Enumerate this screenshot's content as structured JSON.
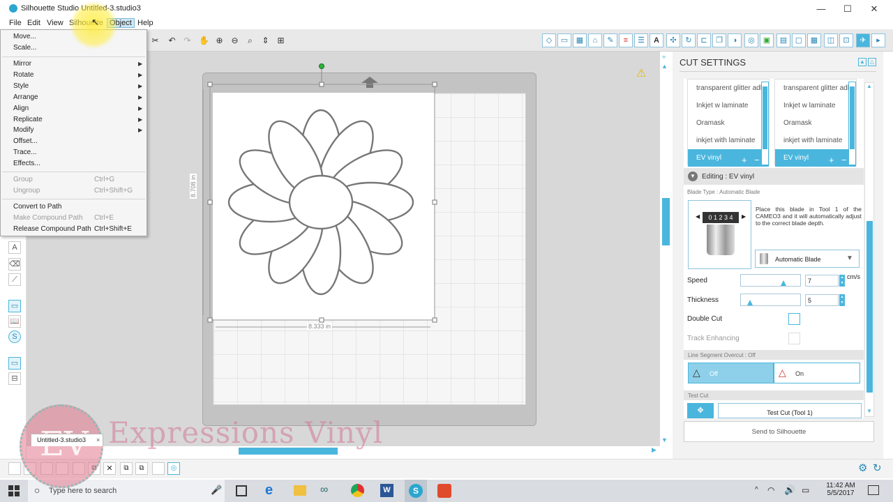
{
  "window": {
    "title_app": "Silhouette Studio",
    "title_doc": "Untitled-3.studio3",
    "minimize": "—",
    "maximize": "☐",
    "close": "✕"
  },
  "menubar": [
    "File",
    "Edit",
    "View",
    "Silhouette",
    "Object",
    "Help"
  ],
  "object_menu": {
    "items": [
      {
        "label": "Move...",
        "enabled": true
      },
      {
        "label": "Scale...",
        "enabled": true
      },
      {
        "label": "Mirror",
        "submenu": true
      },
      {
        "label": "Rotate",
        "submenu": true
      },
      {
        "label": "Style",
        "submenu": true
      },
      {
        "label": "Arrange",
        "submenu": true
      },
      {
        "label": "Align",
        "submenu": true
      },
      {
        "label": "Replicate",
        "submenu": true
      },
      {
        "label": "Modify",
        "submenu": true
      },
      {
        "label": "Offset...",
        "enabled": true
      },
      {
        "label": "Trace...",
        "enabled": true
      },
      {
        "label": "Effects...",
        "enabled": true
      },
      {
        "label": "Group",
        "shortcut": "Ctrl+G",
        "enabled": false
      },
      {
        "label": "Ungroup",
        "shortcut": "Ctrl+Shift+G",
        "enabled": false
      },
      {
        "label": "Convert to Path",
        "enabled": true
      },
      {
        "label": "Make Compound Path",
        "shortcut": "Ctrl+E",
        "enabled": false
      },
      {
        "label": "Release Compound Path",
        "shortcut": "Ctrl+Shift+E",
        "enabled": true
      }
    ]
  },
  "canvas": {
    "width_label": "8.333 in",
    "height_label": "8.708 in"
  },
  "cut_settings": {
    "title": "CUT SETTINGS",
    "materials_left": [
      "transparent glitter adh",
      "Inkjet w laminate",
      "Oramask",
      "inkjet with laminate",
      "EV vinyl"
    ],
    "materials_right": [
      "transparent glitter adhe",
      "Inkjet w laminate",
      "Oramask",
      "inkjet with laminate",
      "EV vinyl"
    ],
    "editing_label": "Editing : EV vinyl",
    "blade_type_label": "Blade Type : Automatic Blade",
    "blade_description": "Place this blade in Tool 1 of the CAMEO3 and it will automatically adjust to the correct blade depth.",
    "blade_digits": "0 1 2 3 4",
    "blade_select": "Automatic Blade",
    "speed_label": "Speed",
    "speed_value": "7",
    "speed_unit": "cm/s",
    "speed_level": 0.7,
    "thickness_label": "Thickness",
    "thickness_value": "5",
    "thickness_level": 0.15,
    "double_cut_label": "Double Cut",
    "track_enhancing_label": "Track Enhancing",
    "overcut_label": "Line Segment Overcut : Off",
    "overcut_off": "Off",
    "overcut_on": "On",
    "test_cut_section": "Test Cut",
    "test_cut_button": "Test Cut (Tool 1)",
    "send_button": "Send to Silhouette"
  },
  "doc_tab": "Untitled-3.studio3",
  "taskbar": {
    "search_placeholder": "Type here to search",
    "time": "11:42 AM",
    "date": "5/5/2017"
  },
  "watermark": {
    "text": "Expressions Vinyl"
  },
  "colors": {
    "accent": "#4ab6dd",
    "menu_highlight": "#cde8f6",
    "flower_stroke": "#777777"
  }
}
